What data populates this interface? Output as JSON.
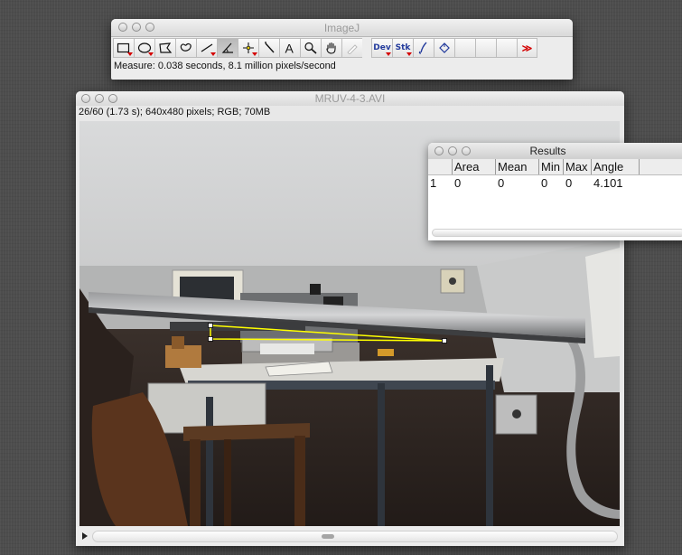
{
  "imagej": {
    "title": "ImageJ",
    "status": "Measure: 0.038 seconds, 8.1 million pixels/second",
    "tools": [
      {
        "name": "rectangle-tool",
        "icon": "rectangle-icon"
      },
      {
        "name": "oval-tool",
        "icon": "oval-icon"
      },
      {
        "name": "polygon-tool",
        "icon": "polygon-icon"
      },
      {
        "name": "freehand-tool",
        "icon": "freehand-icon"
      },
      {
        "name": "line-tool",
        "icon": "line-icon"
      },
      {
        "name": "angle-tool",
        "icon": "angle-icon",
        "selected": true
      },
      {
        "name": "point-tool",
        "icon": "crosshair-icon"
      },
      {
        "name": "wand-tool",
        "icon": "wand-icon"
      },
      {
        "name": "text-tool",
        "icon": "text-icon"
      },
      {
        "name": "magnifier-tool",
        "icon": "magnifier-icon"
      },
      {
        "name": "hand-tool",
        "icon": "hand-icon"
      },
      {
        "name": "color-picker-tool",
        "icon": "dropper-icon"
      }
    ],
    "dev_label": "Dev",
    "stk_label": "Stk",
    "more_label": "≫"
  },
  "image_window": {
    "title": "MRUV-4-3.AVI",
    "info": "26/60 (1.73 s); 640x480 pixels; RGB; 70MB"
  },
  "results": {
    "title": "Results",
    "columns": [
      "",
      "Area",
      "Mean",
      "Min",
      "Max",
      "Angle",
      ""
    ],
    "rows": [
      [
        "1",
        "0",
        "0",
        "0",
        "0",
        "4.101",
        ""
      ]
    ]
  },
  "colors": {
    "angle_selection": "#ffff00",
    "red_arrow": "#d40000",
    "plugin_text": "#223a9c"
  }
}
